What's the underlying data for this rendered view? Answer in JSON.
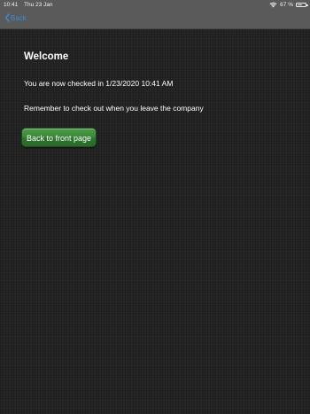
{
  "status_bar": {
    "time": "10:41",
    "date": "Thu 23 Jan",
    "battery": "67 %",
    "battery_level": 0.67,
    "wifi_icon": "wifi-icon"
  },
  "nav": {
    "back_label": "Back",
    "back_icon": "chevron-left-icon",
    "accent_color": "#3a8bdc"
  },
  "main": {
    "title": "Welcome",
    "checked_in_text": "You are now checked in 1/23/2020 10:41 AM",
    "reminder_text": "Remember to check out when you leave the company",
    "front_page_button": "Back to front page",
    "button_color": "#3d8a3a"
  }
}
